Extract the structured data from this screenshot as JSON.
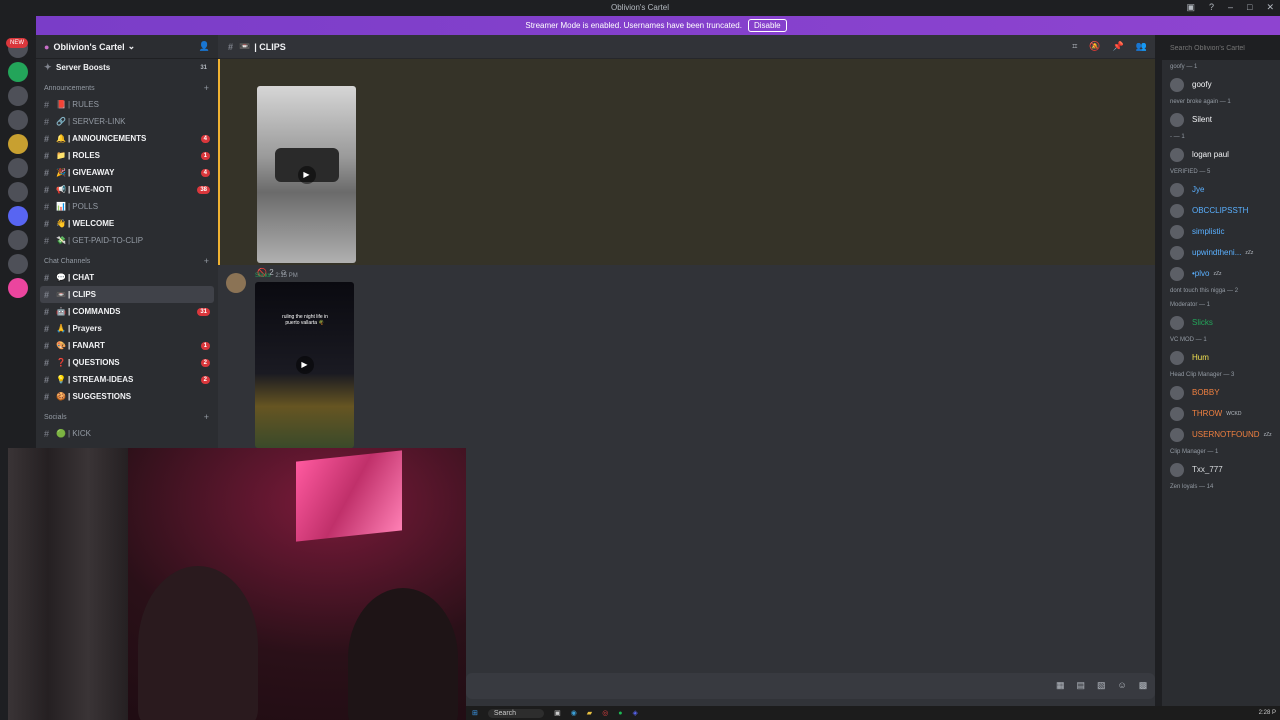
{
  "window": {
    "title": "Oblivion's Cartel"
  },
  "banner": {
    "text": "Streamer Mode is enabled. Usernames have been truncated.",
    "button": "Disable"
  },
  "servers": {
    "new_badge": "NEW"
  },
  "guild": {
    "name": "Oblivion's Cartel",
    "boosts": "Server Boosts",
    "boost_count": "31"
  },
  "categories": {
    "announcements": "Announcements",
    "chat": "Chat Channels",
    "socials": "Socials"
  },
  "channels_announce": [
    {
      "name": "| RULES",
      "emoji": "📕",
      "bold": false,
      "badge": ""
    },
    {
      "name": "| SERVER-LINK",
      "emoji": "🔗",
      "bold": false,
      "badge": ""
    },
    {
      "name": "| ANNOUNCEMENTS",
      "emoji": "🔔",
      "bold": true,
      "badge": "4"
    },
    {
      "name": "| ROLES",
      "emoji": "📁",
      "bold": true,
      "badge": "1"
    },
    {
      "name": "| GIVEAWAY",
      "emoji": "🎉",
      "bold": true,
      "badge": "4"
    },
    {
      "name": "| LIVE-NOTI",
      "emoji": "📢",
      "bold": true,
      "badge": "38"
    },
    {
      "name": "| POLLS",
      "emoji": "📊",
      "bold": false,
      "badge": ""
    },
    {
      "name": "| WELCOME",
      "emoji": "👋",
      "bold": true,
      "badge": ""
    },
    {
      "name": "| GET-PAID-TO-CLIP",
      "emoji": "💸",
      "bold": false,
      "badge": ""
    }
  ],
  "channels_chat": [
    {
      "name": "| CHAT",
      "emoji": "💬",
      "bold": true,
      "badge": ""
    },
    {
      "name": "| CLIPS",
      "emoji": "📼",
      "bold": true,
      "badge": "",
      "selected": true
    },
    {
      "name": "| COMMANDS",
      "emoji": "🤖",
      "bold": true,
      "badge": "31"
    },
    {
      "name": "| Prayers",
      "emoji": "🙏",
      "bold": true,
      "badge": ""
    },
    {
      "name": "| FANART",
      "emoji": "🎨",
      "bold": true,
      "badge": "1"
    },
    {
      "name": "| QUESTIONS",
      "emoji": "❓",
      "bold": true,
      "badge": "2"
    },
    {
      "name": "| STREAM-IDEAS",
      "emoji": "💡",
      "bold": true,
      "badge": "2"
    },
    {
      "name": "| SUGGESTIONS",
      "emoji": "🍪",
      "bold": true,
      "badge": ""
    }
  ],
  "channels_social": [
    {
      "name": "| KICK",
      "emoji": "🟢"
    }
  ],
  "main": {
    "channel": "| CLIPS",
    "search_placeholder": "Search Oblivion's Cartel"
  },
  "messages": [
    {
      "reaction_count": "2"
    },
    {
      "author": "Slicks",
      "time": "2:15 PM",
      "caption": "ruling the night life in puerto vallarta 🌴"
    }
  ],
  "members": [
    {
      "role": "goofy — 1",
      "users": [
        {
          "name": "goofy",
          "color": "#f2f3f5",
          "tag": ""
        }
      ]
    },
    {
      "role": "never broke again — 1",
      "users": [
        {
          "name": "Silent",
          "color": "#f2f3f5",
          "tag": ""
        }
      ]
    },
    {
      "role": "- — 1",
      "users": [
        {
          "name": "logan paul",
          "color": "#f2f3f5",
          "tag": ""
        }
      ]
    },
    {
      "role": "VERIFIED — 5",
      "users": [
        {
          "name": "Jye",
          "color": "#5ab0ff",
          "tag": ""
        },
        {
          "name": "OBCCLIPSSTH",
          "color": "#5ab0ff",
          "tag": ""
        },
        {
          "name": "simplistic",
          "color": "#5ab0ff",
          "tag": ""
        },
        {
          "name": "upwindtheni...",
          "color": "#5ab0ff",
          "tag": "zZz"
        },
        {
          "name": "•plvo",
          "color": "#5ab0ff",
          "tag": "zZz"
        }
      ]
    },
    {
      "role": "dont touch this nigga — 2",
      "users": []
    },
    {
      "role": "Moderator — 1",
      "users": [
        {
          "name": "Slicks",
          "color": "#23a55a",
          "tag": ""
        }
      ]
    },
    {
      "role": "VC MOD — 1",
      "users": [
        {
          "name": "Hum",
          "color": "#f0e050",
          "tag": ""
        }
      ]
    },
    {
      "role": "Head Clip Manager — 3",
      "users": [
        {
          "name": "BOBBY",
          "color": "#f08040",
          "tag": ""
        },
        {
          "name": "THROW",
          "color": "#f08040",
          "tag": "WCKD"
        },
        {
          "name": "USERNOTFOUND",
          "color": "#f08040",
          "tag": "zZz"
        }
      ]
    },
    {
      "role": "Clip Manager — 1",
      "users": [
        {
          "name": "Txx_777",
          "color": "#dbdee1",
          "tag": ""
        }
      ]
    },
    {
      "role": "Zen loyals — 14",
      "users": []
    }
  ],
  "taskbar": {
    "search": "Search",
    "clock": "2:28 P"
  }
}
